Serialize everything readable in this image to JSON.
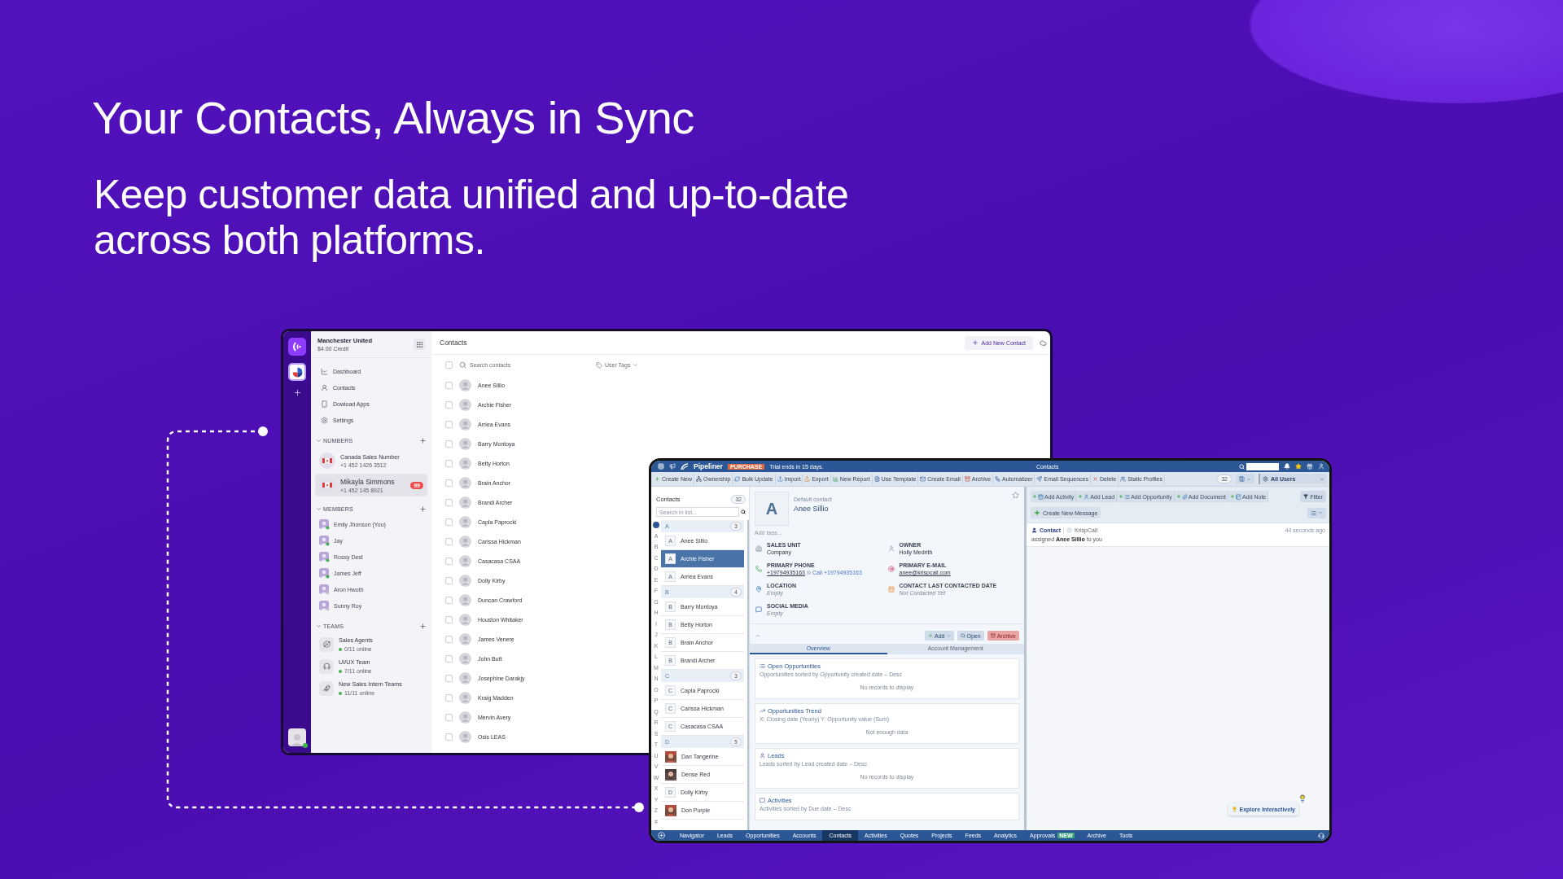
{
  "headline": "Your Contacts, Always in Sync",
  "subheadline": "Keep customer data unified and up-to-date across both platforms.",
  "krisp_window": {
    "workspace": {
      "name": "Manchester United",
      "credit": "$4.00 Credit"
    },
    "nav": [
      {
        "label": "Dashboard",
        "kind": "dashboard"
      },
      {
        "label": "Contacts",
        "kind": "contacts"
      },
      {
        "label": "Dowload Apps",
        "kind": "apps"
      },
      {
        "label": "Settings",
        "kind": "settings"
      }
    ],
    "numbers": {
      "title": "NUMBERS",
      "items": [
        {
          "name": "Canada Sales Number",
          "phone": "+1 452 1426 3512",
          "selected": false
        },
        {
          "name": "Mikayla Simmons",
          "phone": "+1 452 145 8921",
          "selected": true,
          "badge": "99"
        }
      ]
    },
    "members": {
      "title": "MEMBERS",
      "items": [
        {
          "name": "Emily Jhonson (You)",
          "online": true
        },
        {
          "name": "Jay",
          "online": true
        },
        {
          "name": "Rossy Dest",
          "online": true
        },
        {
          "name": "James Jeff",
          "online": true
        },
        {
          "name": "Aron Hwoth",
          "online": false
        },
        {
          "name": "Sunny Roy",
          "online": false
        }
      ]
    },
    "teams": {
      "title": "TEAMS",
      "items": [
        {
          "name": "Sales Agents",
          "status": "0/11 online",
          "kind": "planet"
        },
        {
          "name": "UI/UX Team",
          "status": "7/11 online",
          "kind": "headphones"
        },
        {
          "name": "New Sales Intern Teams",
          "status": "11/11 online",
          "kind": "bird"
        }
      ]
    },
    "contacts": {
      "title": "Contacts",
      "add_button": "Add New Contact",
      "search_placeholder": "Search contacts",
      "tags_filter": "User Tags",
      "select_all_checked": false,
      "rows": [
        {
          "name": "Anee Sillio",
          "checked": false
        },
        {
          "name": "Archie Fisher",
          "checked": false
        },
        {
          "name": "Arriea Evans",
          "checked": false
        },
        {
          "name": "Barry Montoya",
          "checked": false
        },
        {
          "name": "Betty Horton",
          "checked": false
        },
        {
          "name": "Brain Anchor",
          "checked": false
        },
        {
          "name": "Brandi Archer",
          "checked": false
        },
        {
          "name": "Capla Paprocki",
          "checked": false
        },
        {
          "name": "Carissa Hickman",
          "checked": false
        },
        {
          "name": "Casacasa CSAA",
          "checked": false
        },
        {
          "name": "Dolly Kirby",
          "checked": false
        },
        {
          "name": "Duncan Crawford",
          "checked": false
        },
        {
          "name": "Houston Whitaker",
          "checked": false
        },
        {
          "name": "James Venere",
          "checked": false
        },
        {
          "name": "John Butt",
          "checked": false
        },
        {
          "name": "Josephine Darakjy",
          "checked": false
        },
        {
          "name": "Kraig Madden",
          "checked": false
        },
        {
          "name": "Mervin Avery",
          "checked": false
        },
        {
          "name": "Osis LEAS",
          "checked": false
        }
      ]
    }
  },
  "pipeliner_window": {
    "topbar": {
      "brand": "Pipeliner",
      "badge": "PURCHASE",
      "trial": "Trial ends in 15 days.",
      "title": "Contacts"
    },
    "toolbar": [
      {
        "label": "Create New",
        "kind": "create"
      },
      {
        "label": "Ownership",
        "kind": "ownership"
      },
      {
        "label": "Bulk Update",
        "kind": "bulk"
      },
      {
        "label": "Import",
        "kind": "import"
      },
      {
        "label": "Export",
        "kind": "export"
      },
      {
        "label": "New Report",
        "kind": "report"
      },
      {
        "label": "Use Template",
        "kind": "template"
      },
      {
        "label": "Create Email",
        "kind": "email"
      },
      {
        "label": "Archive",
        "kind": "archive"
      },
      {
        "label": "Automatizer",
        "kind": "automatizer"
      },
      {
        "label": "Email Sequences",
        "kind": "sequences"
      },
      {
        "label": "Delete",
        "kind": "delete"
      },
      {
        "label": "Static Profiles",
        "kind": "profiles"
      }
    ],
    "toolbar_right": {
      "count": "32",
      "users_filter": "All Users"
    },
    "list": {
      "title": "Contacts",
      "count": "32",
      "search_placeholder": "Search in list...",
      "index": [
        "A",
        "B",
        "C",
        "D",
        "E",
        "F",
        "G",
        "H",
        "I",
        "J",
        "K",
        "L",
        "M",
        "N",
        "O",
        "P",
        "Q",
        "R",
        "S",
        "T",
        "U",
        "V",
        "W",
        "X",
        "Y",
        "Z",
        "#"
      ],
      "sections": [
        {
          "letter": "A",
          "count": "3",
          "rows": [
            {
              "kind": "initial",
              "initial": "A",
              "name": "Anee Sillio",
              "selected": false
            },
            {
              "kind": "initial",
              "initial": "A",
              "name": "Archie Fisher",
              "selected": true
            },
            {
              "kind": "initial",
              "initial": "A",
              "name": "Arriea Evans",
              "selected": false
            }
          ]
        },
        {
          "letter": "B",
          "count": "4",
          "rows": [
            {
              "kind": "initial",
              "initial": "B",
              "name": "Barry Montoya",
              "selected": false
            },
            {
              "kind": "initial",
              "initial": "B",
              "name": "Betty Horton",
              "selected": false
            },
            {
              "kind": "initial",
              "initial": "B",
              "name": "Brain Anchor",
              "selected": false
            },
            {
              "kind": "initial",
              "initial": "B",
              "name": "Brandi Archer",
              "selected": false
            }
          ]
        },
        {
          "letter": "C",
          "count": "3",
          "rows": [
            {
              "kind": "initial",
              "initial": "C",
              "name": "Capla Paprocki",
              "selected": false
            },
            {
              "kind": "initial",
              "initial": "C",
              "name": "Carissa Hickman",
              "selected": false
            },
            {
              "kind": "initial",
              "initial": "C",
              "name": "Casacasa CSAA",
              "selected": false
            }
          ]
        },
        {
          "letter": "D",
          "count": "5",
          "rows": [
            {
              "kind": "picture",
              "name": "Dan Tangerine",
              "selected": false
            },
            {
              "kind": "picture",
              "name": "Dense Red",
              "selected": false
            },
            {
              "kind": "initial",
              "initial": "D",
              "name": "Dolly Kirby",
              "selected": false
            },
            {
              "kind": "picture",
              "name": "Don Purple",
              "selected": false
            }
          ]
        }
      ]
    },
    "detail": {
      "avatar": "A",
      "caption": "Default contact",
      "name": "Anee Sillio",
      "tags_placeholder": "Add tags...",
      "fields": [
        {
          "label": "SALES UNIT",
          "value": "Company",
          "kind": "unit",
          "empty": false
        },
        {
          "label": "OWNER",
          "value": "Holly Medrith",
          "kind": "owner",
          "empty": false
        },
        {
          "label": "PRIMARY PHONE",
          "value": "+19794935163",
          "call_link": "Call +19794935163",
          "kind": "phone",
          "empty": false
        },
        {
          "label": "PRIMARY E-MAIL",
          "value": "anee@krispcall.com",
          "kind": "email",
          "empty": false
        },
        {
          "label": "LOCATION",
          "value": "Empty",
          "kind": "location",
          "empty": true
        },
        {
          "label": "CONTACT LAST CONTACTED DATE",
          "value": "Not Contacted Yet",
          "kind": "date",
          "empty": true
        },
        {
          "label": "SOCIAL MEDIA",
          "value": "Empty",
          "kind": "social",
          "empty": true
        }
      ],
      "actions": [
        {
          "label": "Add",
          "kind": "add"
        },
        {
          "label": "Open",
          "kind": "open"
        },
        {
          "label": "Archive",
          "kind": "archive"
        }
      ],
      "tabs": [
        {
          "label": "Overview",
          "selected": true
        },
        {
          "label": "Account Management",
          "selected": false
        }
      ],
      "cards": [
        {
          "kind": "opportunities",
          "title": "Open Opportunities",
          "subtitle": "Opportunities sorted by Opportunity created date – Desc",
          "message": "No records to display"
        },
        {
          "kind": "trend",
          "title": "Opportunities Trend",
          "subtitle": "X: Closing date (Yearly) Y: Opportunity value (Sum)",
          "message": "Not enough data"
        },
        {
          "kind": "leads",
          "title": "Leads",
          "subtitle": "Leads sorted by Lead created date – Desc",
          "message": "No records to display"
        },
        {
          "kind": "activities",
          "title": "Activities",
          "subtitle": "Activities sorted by Due date – Desc"
        }
      ]
    },
    "feed": {
      "actions": [
        {
          "label": "Add Activity",
          "kind": "activity"
        },
        {
          "label": "Add Lead",
          "kind": "lead"
        },
        {
          "label": "Add Opportunity",
          "kind": "opportunity"
        },
        {
          "label": "Add Document",
          "kind": "document"
        },
        {
          "label": "Add Note",
          "kind": "note"
        }
      ],
      "filter": "Filter",
      "create_message": "Create New Message",
      "entries": [
        {
          "type_label": "Contact",
          "source": "KrispCall",
          "time": "44 seconds ago",
          "text": "assigned **Anee Sillio** to you"
        }
      ],
      "explore": "Explore Interactively"
    },
    "bottom_nav": [
      {
        "label": "Navigator",
        "selected": false
      },
      {
        "label": "Leads",
        "selected": false
      },
      {
        "label": "Opportunities",
        "selected": false
      },
      {
        "label": "Accounts",
        "selected": false
      },
      {
        "label": "Contacts",
        "selected": true
      },
      {
        "label": "Activities",
        "selected": false
      },
      {
        "label": "Quotes",
        "selected": false
      },
      {
        "label": "Projects",
        "selected": false
      },
      {
        "label": "Feeds",
        "selected": false
      },
      {
        "label": "Analytics",
        "selected": false
      },
      {
        "label": "Approvals",
        "selected": false,
        "badge": "NEW"
      },
      {
        "label": "Archive",
        "selected": false
      },
      {
        "label": "Tools",
        "selected": false
      }
    ]
  }
}
